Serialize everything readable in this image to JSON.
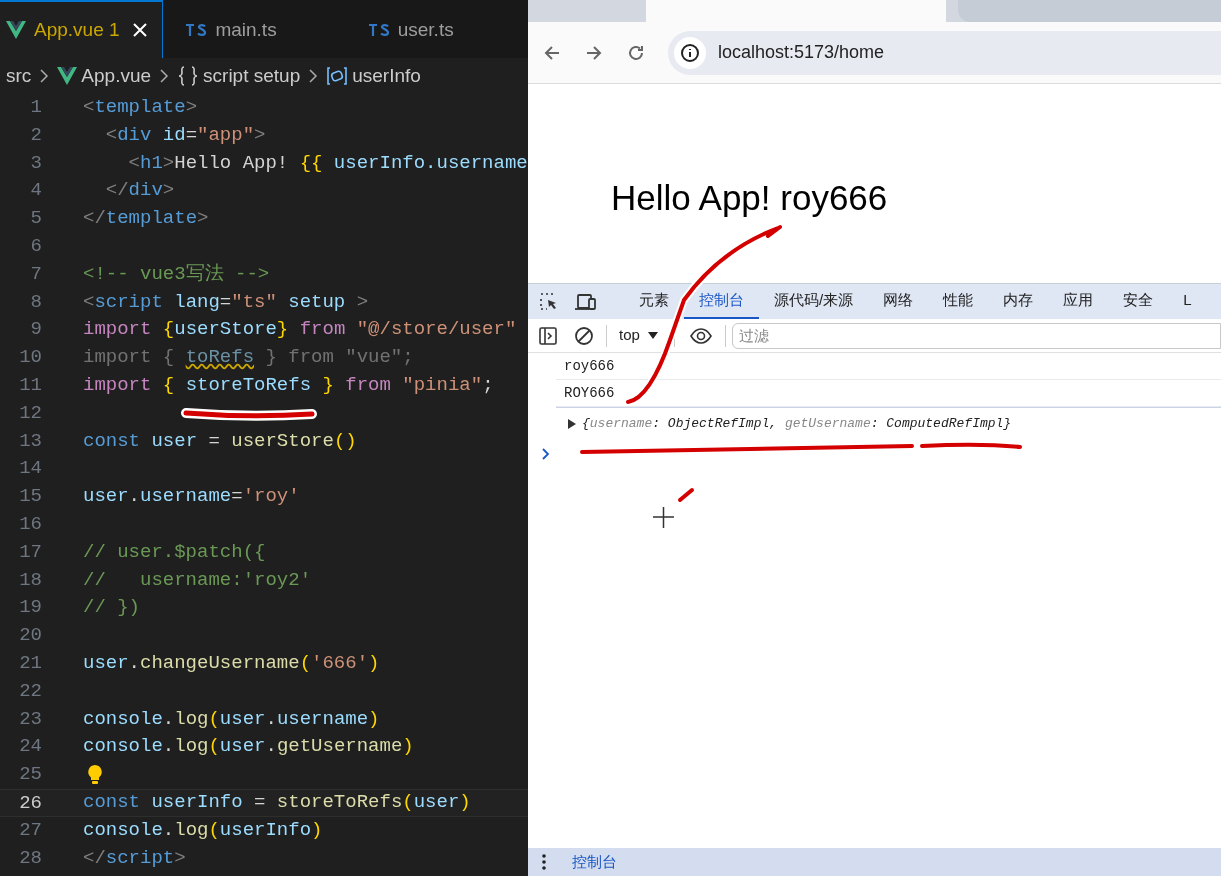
{
  "editor": {
    "tabs": [
      {
        "label": "App.vue",
        "kind": "vue",
        "problems": "1",
        "selected": true
      },
      {
        "label": "main.ts",
        "kind": "ts",
        "selected": false
      },
      {
        "label": "user.ts",
        "kind": "ts",
        "selected": false
      }
    ],
    "breadcrumb": [
      {
        "label": "src",
        "kind": "folder"
      },
      {
        "label": "App.vue",
        "kind": "vue"
      },
      {
        "label": "script setup",
        "kind": "braces"
      },
      {
        "label": "userInfo",
        "kind": "variable"
      }
    ],
    "lines": [
      {
        "number": "1",
        "tokens": [
          {
            "text": "<",
            "kind": "punct"
          },
          {
            "text": "template",
            "kind": "tag"
          },
          {
            "text": ">",
            "kind": "punct"
          }
        ]
      },
      {
        "number": "2",
        "tokens": [
          {
            "text": "  <",
            "kind": "punct"
          },
          {
            "text": "div ",
            "kind": "tag"
          },
          {
            "text": "id",
            "kind": "attr"
          },
          {
            "text": "=",
            "kind": "text"
          },
          {
            "text": "\"app\"",
            "kind": "str"
          },
          {
            "text": ">",
            "kind": "punct"
          }
        ]
      },
      {
        "number": "3",
        "tokens": [
          {
            "text": "    <",
            "kind": "punct"
          },
          {
            "text": "h1",
            "kind": "tag"
          },
          {
            "text": ">",
            "kind": "punct"
          },
          {
            "text": "Hello App! ",
            "kind": "text"
          },
          {
            "text": "{{",
            "kind": "brace"
          },
          {
            "text": " userInfo.username",
            "kind": "var"
          }
        ]
      },
      {
        "number": "4",
        "tokens": [
          {
            "text": "  </",
            "kind": "punct"
          },
          {
            "text": "div",
            "kind": "tag"
          },
          {
            "text": ">",
            "kind": "punct"
          }
        ]
      },
      {
        "number": "5",
        "tokens": [
          {
            "text": "</",
            "kind": "punct"
          },
          {
            "text": "template",
            "kind": "tag"
          },
          {
            "text": ">",
            "kind": "punct"
          }
        ]
      },
      {
        "number": "6"
      },
      {
        "number": "7",
        "tokens": [
          {
            "text": "<!-- vue3写法 -->",
            "kind": "comment"
          }
        ]
      },
      {
        "number": "8",
        "tokens": [
          {
            "text": "<",
            "kind": "punct"
          },
          {
            "text": "script ",
            "kind": "tag"
          },
          {
            "text": "lang",
            "kind": "attr"
          },
          {
            "text": "=",
            "kind": "text"
          },
          {
            "text": "\"ts\" ",
            "kind": "str"
          },
          {
            "text": "setup",
            "kind": "attr"
          },
          {
            "text": " >",
            "kind": "punct"
          }
        ]
      },
      {
        "number": "9",
        "tokens": [
          {
            "text": "import ",
            "kind": "kw"
          },
          {
            "text": "{",
            "kind": "brace"
          },
          {
            "text": "userStore",
            "kind": "var"
          },
          {
            "text": "} ",
            "kind": "brace"
          },
          {
            "text": "from ",
            "kind": "kw"
          },
          {
            "text": "\"@/store/user\"",
            "kind": "str"
          }
        ]
      },
      {
        "number": "10",
        "tokens": [
          {
            "text": "import { ",
            "kind": "unused"
          },
          {
            "text": "toRefs",
            "kind": "unused_warn"
          },
          {
            "text": " } from \"vue\";",
            "kind": "unused"
          }
        ]
      },
      {
        "number": "11",
        "tokens": [
          {
            "text": "import ",
            "kind": "kw"
          },
          {
            "text": "{",
            "kind": "brace"
          },
          {
            "text": " storeToRefs ",
            "kind": "var"
          },
          {
            "text": "} ",
            "kind": "brace"
          },
          {
            "text": "from ",
            "kind": "kw"
          },
          {
            "text": "\"pinia\"",
            "kind": "str"
          },
          {
            "text": ";",
            "kind": "text"
          }
        ]
      },
      {
        "number": "12"
      },
      {
        "number": "13",
        "tokens": [
          {
            "text": "const ",
            "kind": "const"
          },
          {
            "text": "user",
            "kind": "var"
          },
          {
            "text": " = ",
            "kind": "text"
          },
          {
            "text": "userStore",
            "kind": "fn"
          },
          {
            "text": "()",
            "kind": "brace"
          }
        ]
      },
      {
        "number": "14"
      },
      {
        "number": "15",
        "tokens": [
          {
            "text": "user",
            "kind": "var"
          },
          {
            "text": ".",
            "kind": "text"
          },
          {
            "text": "username",
            "kind": "var"
          },
          {
            "text": "=",
            "kind": "text"
          },
          {
            "text": "'roy'",
            "kind": "str"
          }
        ]
      },
      {
        "number": "16"
      },
      {
        "number": "17",
        "tokens": [
          {
            "text": "// user.$patch({",
            "kind": "comment"
          }
        ]
      },
      {
        "number": "18",
        "tokens": [
          {
            "text": "//   username:'roy2'",
            "kind": "comment"
          }
        ]
      },
      {
        "number": "19",
        "tokens": [
          {
            "text": "// })",
            "kind": "comment"
          }
        ]
      },
      {
        "number": "20"
      },
      {
        "number": "21",
        "tokens": [
          {
            "text": "user",
            "kind": "var"
          },
          {
            "text": ".",
            "kind": "text"
          },
          {
            "text": "changeUsername",
            "kind": "fn"
          },
          {
            "text": "(",
            "kind": "brace"
          },
          {
            "text": "'666'",
            "kind": "str"
          },
          {
            "text": ")",
            "kind": "brace"
          }
        ]
      },
      {
        "number": "22"
      },
      {
        "number": "23",
        "tokens": [
          {
            "text": "console",
            "kind": "var"
          },
          {
            "text": ".",
            "kind": "text"
          },
          {
            "text": "log",
            "kind": "fn"
          },
          {
            "text": "(",
            "kind": "brace"
          },
          {
            "text": "user",
            "kind": "var"
          },
          {
            "text": ".",
            "kind": "text"
          },
          {
            "text": "username",
            "kind": "var"
          },
          {
            "text": ")",
            "kind": "brace"
          }
        ]
      },
      {
        "number": "24",
        "tokens": [
          {
            "text": "console",
            "kind": "var"
          },
          {
            "text": ".",
            "kind": "text"
          },
          {
            "text": "log",
            "kind": "fn"
          },
          {
            "text": "(",
            "kind": "brace"
          },
          {
            "text": "user",
            "kind": "var"
          },
          {
            "text": ".",
            "kind": "text"
          },
          {
            "text": "getUsername",
            "kind": "fn"
          },
          {
            "text": ")",
            "kind": "brace"
          }
        ]
      },
      {
        "number": "25",
        "lightbulb": true
      },
      {
        "number": "26",
        "current": true,
        "tokens": [
          {
            "text": "const ",
            "kind": "const"
          },
          {
            "text": "userInfo",
            "kind": "var"
          },
          {
            "text": " = ",
            "kind": "text"
          },
          {
            "text": "storeToRefs",
            "kind": "fn"
          },
          {
            "text": "(",
            "kind": "brace"
          },
          {
            "text": "user",
            "kind": "var"
          },
          {
            "text": ")",
            "kind": "brace"
          }
        ]
      },
      {
        "number": "27",
        "tokens": [
          {
            "text": "console",
            "kind": "var"
          },
          {
            "text": ".",
            "kind": "text"
          },
          {
            "text": "log",
            "kind": "fn"
          },
          {
            "text": "(",
            "kind": "brace"
          },
          {
            "text": "userInfo",
            "kind": "var"
          },
          {
            "text": ")",
            "kind": "brace"
          }
        ]
      },
      {
        "number": "28",
        "tokens": [
          {
            "text": "</",
            "kind": "punct"
          },
          {
            "text": "script",
            "kind": "tag"
          },
          {
            "text": ">",
            "kind": "punct"
          }
        ]
      }
    ]
  },
  "browser": {
    "url": "localhost:5173/home",
    "heading": "Hello App! roy666"
  },
  "devtools": {
    "tabs": [
      {
        "label": "元素",
        "selected": false
      },
      {
        "label": "控制台",
        "selected": true
      },
      {
        "label": "源代码/来源",
        "selected": false
      },
      {
        "label": "网络",
        "selected": false
      },
      {
        "label": "性能",
        "selected": false
      },
      {
        "label": "内存",
        "selected": false
      },
      {
        "label": "应用",
        "selected": false
      },
      {
        "label": "安全",
        "selected": false
      },
      {
        "label": "L",
        "selected": false
      }
    ],
    "context": "top",
    "filter_placeholder": "过滤",
    "messages": [
      {
        "kind": "log",
        "text": "roy666"
      },
      {
        "kind": "log",
        "text": "ROY666"
      },
      {
        "kind": "object",
        "tokens": [
          {
            "text": "{",
            "kind": "punct"
          },
          {
            "text": "username",
            "kind": "key"
          },
          {
            "text": ": ",
            "kind": "punct"
          },
          {
            "text": "ObjectRefImpl",
            "kind": "value"
          },
          {
            "text": ", ",
            "kind": "punct"
          },
          {
            "text": "getUsername",
            "kind": "key"
          },
          {
            "text": ": ",
            "kind": "punct"
          },
          {
            "text": "ComputedRefImpl",
            "kind": "value"
          },
          {
            "text": "}",
            "kind": "punct"
          }
        ]
      }
    ],
    "drawer_tab": "控制台"
  }
}
